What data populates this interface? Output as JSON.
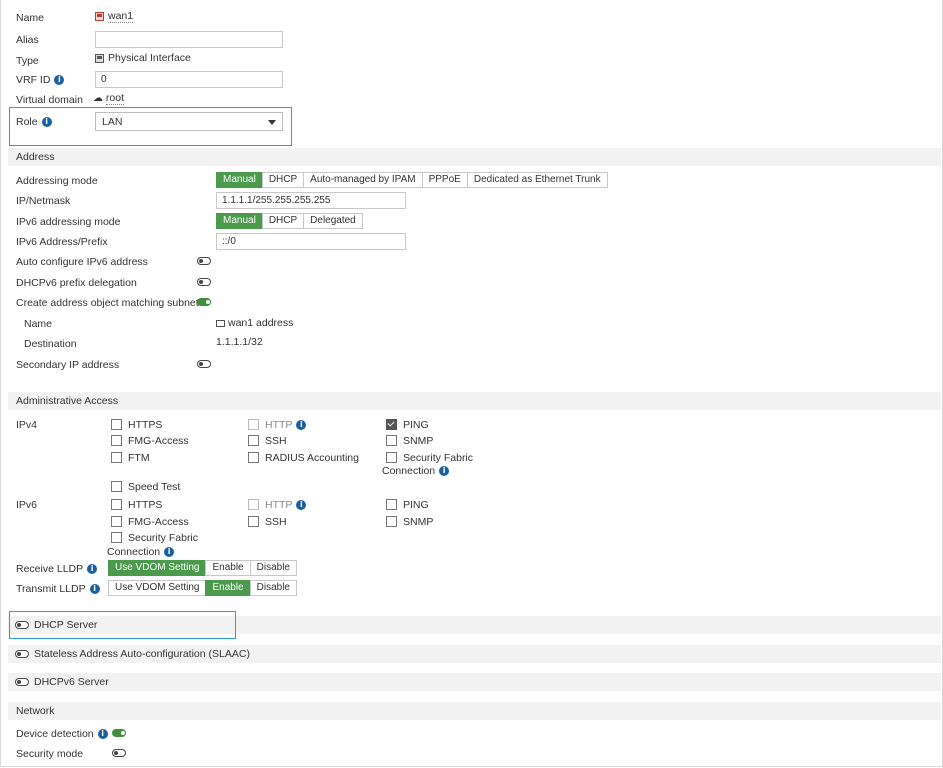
{
  "form": {
    "name_label": "Name",
    "name_value": "wan1",
    "alias_label": "Alias",
    "alias_value": "",
    "type_label": "Type",
    "type_value": "Physical Interface",
    "vrf_label": "VRF ID",
    "vrf_value": "0",
    "vdom_label": "Virtual domain",
    "vdom_value": "root",
    "role_label": "Role",
    "role_value": "LAN"
  },
  "address": {
    "section_title": "Address",
    "addressing_mode_label": "Addressing mode",
    "addressing_modes": [
      "Manual",
      "DHCP",
      "Auto-managed by IPAM",
      "PPPoE",
      "Dedicated as Ethernet Trunk"
    ],
    "addressing_mode_selected": "Manual",
    "ip_netmask_label": "IP/Netmask",
    "ip_netmask_value": "1.1.1.1/255.255.255.255",
    "ipv6_mode_label": "IPv6 addressing mode",
    "ipv6_modes": [
      "Manual",
      "DHCP",
      "Delegated"
    ],
    "ipv6_mode_selected": "Manual",
    "ipv6_prefix_label": "IPv6 Address/Prefix",
    "ipv6_prefix_value": "::/0",
    "auto_ipv6_label": "Auto configure IPv6 address",
    "dhcpv6_prefix_label": "DHCPv6 prefix delegation",
    "create_obj_label": "Create address object matching subnet",
    "obj_name_label": "Name",
    "obj_name_value": "wan1 address",
    "obj_dest_label": "Destination",
    "obj_dest_value": "1.1.1.1/32",
    "secondary_label": "Secondary IP address"
  },
  "admin": {
    "section_title": "Administrative Access",
    "ipv4_label": "IPv4",
    "ipv4": {
      "https": "HTTPS",
      "http": "HTTP",
      "ping": "PING",
      "fmg": "FMG-Access",
      "ssh": "SSH",
      "snmp": "SNMP",
      "ftm": "FTM",
      "radius": "RADIUS Accounting",
      "sf_line1": "Security Fabric",
      "sf_line2": "Connection",
      "speed": "Speed Test"
    },
    "ipv6_label": "IPv6",
    "ipv6": {
      "https": "HTTPS",
      "http": "HTTP",
      "ping": "PING",
      "fmg": "FMG-Access",
      "ssh": "SSH",
      "snmp": "SNMP",
      "sf_line1": "Security Fabric",
      "sf_line2": "Connection"
    },
    "receive_lldp_label": "Receive LLDP",
    "transmit_lldp_label": "Transmit LLDP",
    "lldp_options": [
      "Use VDOM Setting",
      "Enable",
      "Disable"
    ],
    "receive_selected": "Use VDOM Setting",
    "transmit_selected": "Enable"
  },
  "dhcp_server_label": "DHCP Server",
  "slaac_label": "Stateless Address Auto-configuration (SLAAC)",
  "dhcpv6_label": "DHCPv6 Server",
  "network": {
    "section_title": "Network",
    "device_detection_label": "Device detection",
    "security_mode_label": "Security mode"
  },
  "colors": {
    "accent_green": "#4c9a4c",
    "highlight_blue": "#2a9fd6",
    "info_blue": "#1a5fa0"
  }
}
